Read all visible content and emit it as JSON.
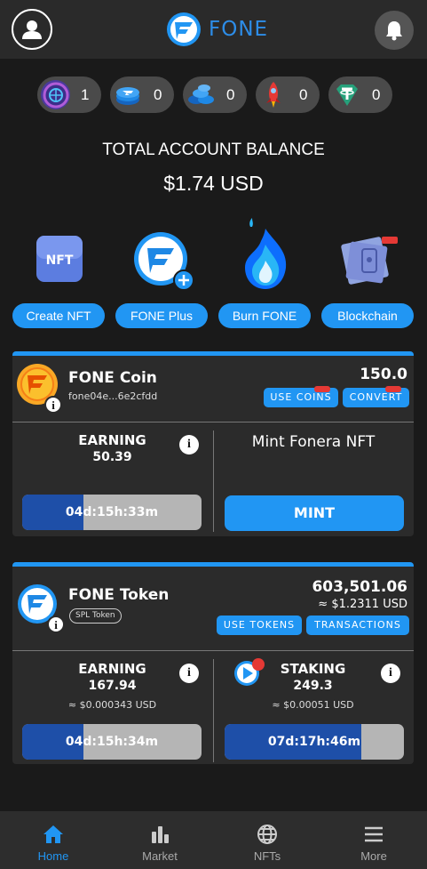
{
  "header": {
    "brand": "FONE"
  },
  "chips": [
    {
      "icon": "nft-globe-icon",
      "count": "1"
    },
    {
      "icon": "fone-coin-stack-icon",
      "count": "0"
    },
    {
      "icon": "fone-coins-pile-icon",
      "count": "0"
    },
    {
      "icon": "rocket-icon",
      "count": "0"
    },
    {
      "icon": "tether-icon",
      "count": "0"
    }
  ],
  "balance": {
    "title": "TOTAL ACCOUNT BALANCE",
    "value": "$1.74 USD"
  },
  "actions": [
    {
      "label": "Create NFT",
      "icon": "nft-tile-icon"
    },
    {
      "label": "FONE Plus",
      "icon": "fone-plus-icon"
    },
    {
      "label": "Burn FONE",
      "icon": "flame-icon"
    },
    {
      "label": "Blockchain",
      "icon": "blockchain-icon"
    }
  ],
  "coin_card": {
    "title": "FONE Coin",
    "address": "fone04e...6e2cfdd",
    "amount": "150.0",
    "use_btn": "USE COINS",
    "convert_btn": "CONVERT",
    "earning_label": "EARNING",
    "earning_value": "50.39",
    "timer": "04d:15h:33m",
    "timer_progress": 0.34,
    "mint_title": "Mint Fonera NFT",
    "mint_btn": "MINT"
  },
  "token_card": {
    "title": "FONE Token",
    "spl": "SPL Token",
    "amount": "603,501.06",
    "usd": "≈ $1.2311 USD",
    "use_btn": "USE TOKENS",
    "tx_btn": "TRANSACTIONS",
    "earning_label": "EARNING",
    "earning_value": "167.94",
    "earning_usd": "≈ $0.000343 USD",
    "earning_timer": "04d:15h:34m",
    "earning_progress": 0.34,
    "staking_label": "STAKING",
    "staking_value": "249.3",
    "staking_usd": "≈ $0.00051 USD",
    "staking_timer": "07d:17h:46m",
    "staking_progress": 0.76
  },
  "nav": [
    {
      "label": "Home",
      "icon": "home-icon",
      "active": true
    },
    {
      "label": "Market",
      "icon": "bar-chart-icon"
    },
    {
      "label": "NFTs",
      "icon": "globe-icon"
    },
    {
      "label": "More",
      "icon": "hamburger-menu-icon"
    }
  ],
  "colors": {
    "accent": "#2196f3",
    "brand_text": "#2d8de8",
    "background": "#1a1a1a",
    "card": "#2b2b2b",
    "progress_fill": "#1e4fa8"
  }
}
